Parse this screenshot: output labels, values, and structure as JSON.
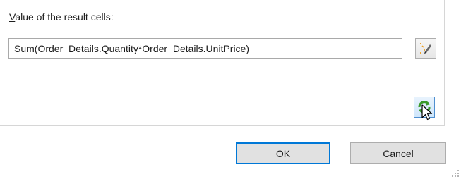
{
  "field": {
    "label_mnemonic": "V",
    "label_rest": "alue of the result cells:",
    "value": "Sum(Order_Details.Quantity*Order_Details.UnitPrice)"
  },
  "icons": {
    "edit": "formula-edit-icon",
    "refresh": "refresh-icon",
    "cursor": "mouse-pointer-icon",
    "grip": "resize-grip-icon"
  },
  "buttons": {
    "ok_label": "OK",
    "cancel_label": "Cancel"
  },
  "colors": {
    "focus_border": "#0078d7",
    "refresh_green": "#3a9a2a"
  }
}
